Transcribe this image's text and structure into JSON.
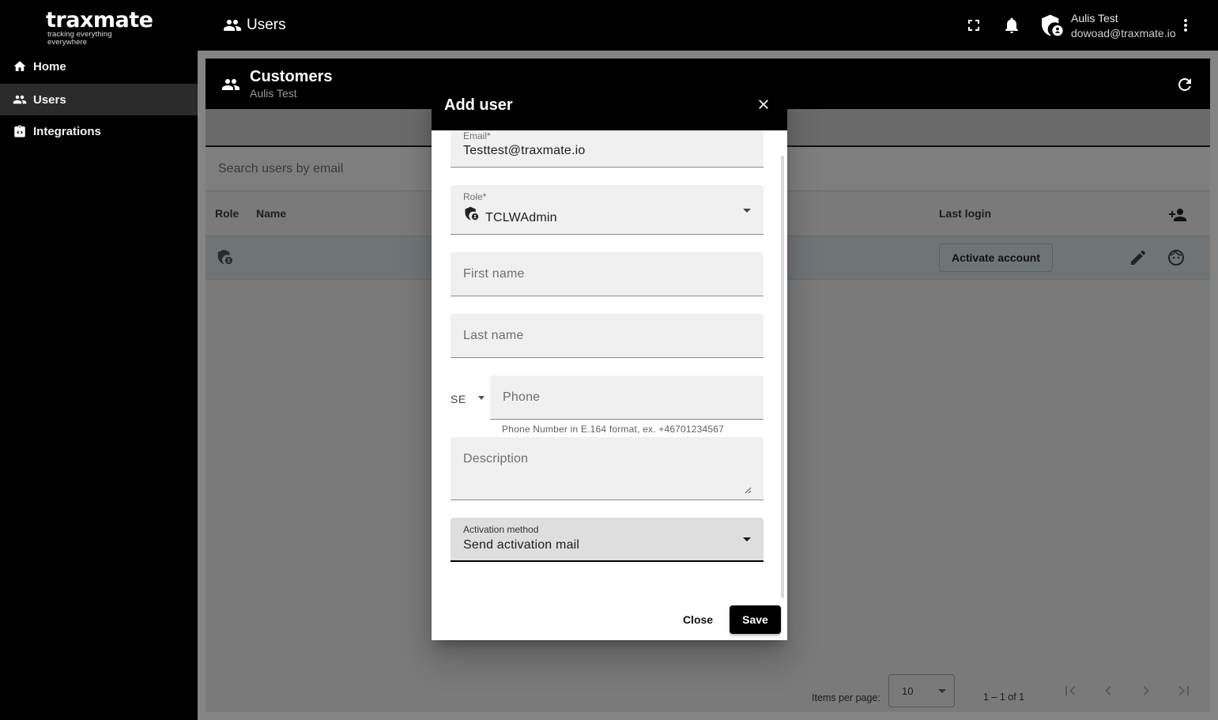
{
  "app": {
    "logo_text": "traxmate",
    "logo_tagline": "tracking everything everywhere",
    "section_title": "Users"
  },
  "user": {
    "name": "Aulis Test",
    "email": "dowoad@traxmate.io"
  },
  "sidebar": {
    "items": [
      {
        "label": "Home",
        "icon": "home-icon",
        "active": false
      },
      {
        "label": "Users",
        "icon": "users-icon",
        "active": true
      },
      {
        "label": "Integrations",
        "icon": "integrations-icon",
        "active": false
      }
    ]
  },
  "card": {
    "title": "Customers",
    "subtitle": "Aulis Test",
    "search_placeholder": "Search users by email",
    "columns": [
      "Role",
      "Name",
      "Last login"
    ],
    "row": {
      "role_icon": "shield-user-icon",
      "action_label": "Activate account"
    },
    "paginator": {
      "items_per_page_label": "Items per page:",
      "items_per_page": "10",
      "range": "1 – 1 of 1"
    }
  },
  "dialog": {
    "title": "Add user",
    "email": {
      "label": "Email*",
      "value": "Testtest@traxmate.io"
    },
    "role": {
      "label": "Role*",
      "value": "TCLWAdmin"
    },
    "first_name": {
      "placeholder": "First name"
    },
    "last_name": {
      "placeholder": "Last name"
    },
    "phone": {
      "country_code": "SE",
      "placeholder": "Phone",
      "hint": "Phone Number in E.164 format, ex. +46701234567"
    },
    "description": {
      "placeholder": "Description"
    },
    "activation": {
      "label": "Activation method",
      "value": "Send activation mail"
    },
    "close_label": "Close",
    "save_label": "Save"
  },
  "colors": {
    "topbar": "#000000",
    "accent": "#000000",
    "field_bg": "#f0f0f0",
    "overlay_dim": "#848484"
  }
}
